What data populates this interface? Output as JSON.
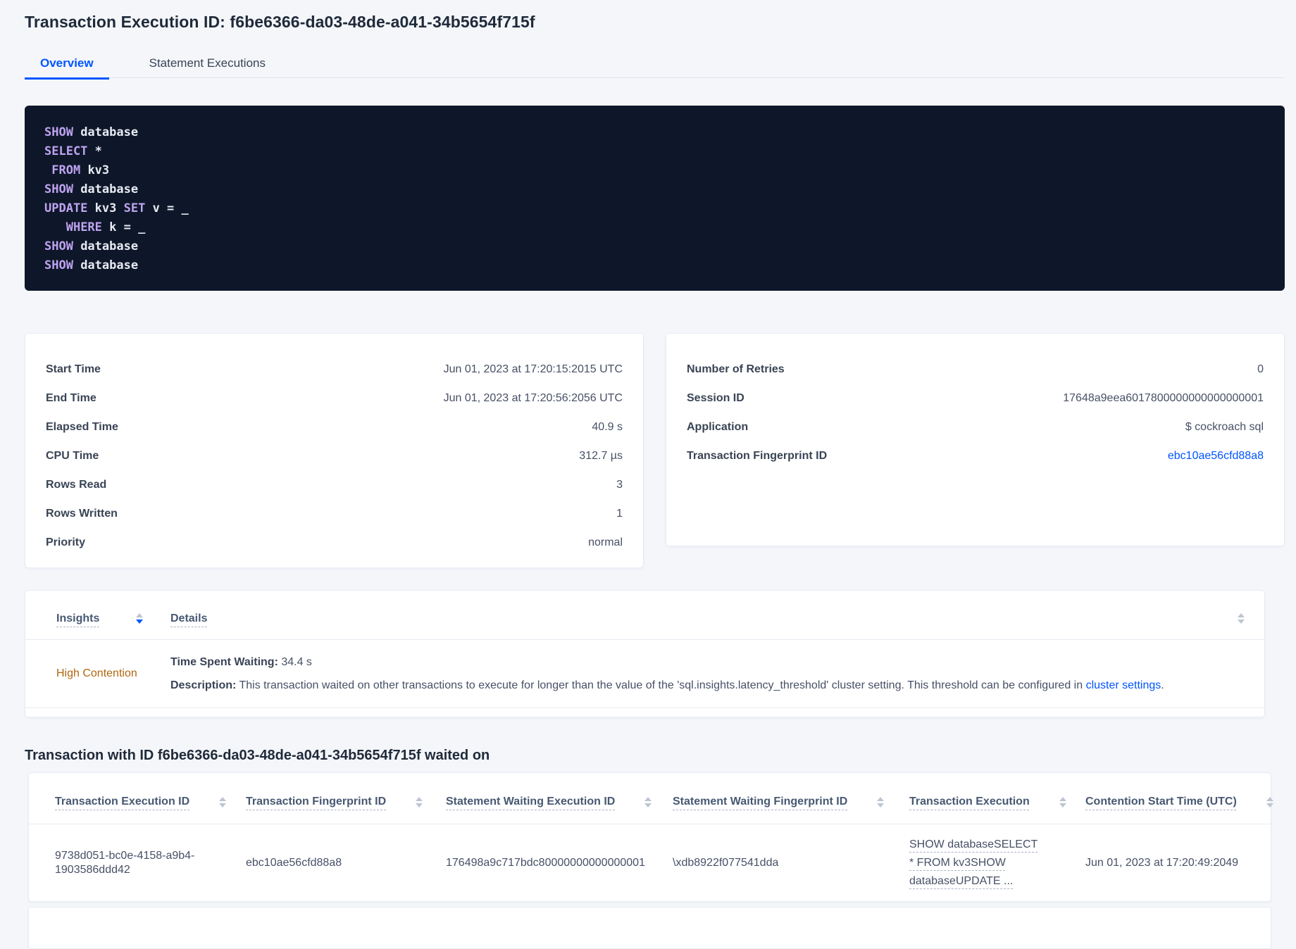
{
  "page": {
    "title": "Transaction Execution ID: f6be6366-da03-48de-a041-34b5654f715f"
  },
  "tabs": [
    {
      "label": "Overview"
    },
    {
      "label": "Statement Executions"
    }
  ],
  "colors": {
    "accent_blue": "#0055ff",
    "insight_orange": "#b0670f",
    "code_background": "#0e1729",
    "code_keyword": "#bfa4f1"
  },
  "sql": {
    "lines": [
      {
        "segs": [
          {
            "t": "SHOW"
          },
          {
            "t": " database"
          }
        ]
      },
      {
        "segs": [
          {
            "t": "SELECT"
          },
          {
            "t": " *"
          }
        ]
      },
      {
        "segs": [
          {
            "t": " "
          },
          {
            "t": "FROM"
          },
          {
            "t": " kv3"
          }
        ]
      },
      {
        "segs": [
          {
            "t": "SHOW"
          },
          {
            "t": " database"
          }
        ]
      },
      {
        "segs": [
          {
            "t": "UPDATE"
          },
          {
            "t": " kv3 "
          },
          {
            "t": "SET"
          },
          {
            "t": " v = _"
          }
        ]
      },
      {
        "segs": [
          {
            "t": "   "
          },
          {
            "t": "WHERE"
          },
          {
            "t": " k = _"
          }
        ]
      },
      {
        "segs": [
          {
            "t": "SHOW"
          },
          {
            "t": " database"
          }
        ]
      },
      {
        "segs": [
          {
            "t": "SHOW"
          },
          {
            "t": " database"
          }
        ]
      }
    ]
  },
  "summary_left": {
    "rows": [
      {
        "label": "Start Time",
        "value": "Jun 01, 2023 at 17:20:15:2015 UTC"
      },
      {
        "label": "End Time",
        "value": "Jun 01, 2023 at 17:20:56:2056 UTC"
      },
      {
        "label": "Elapsed Time",
        "value": "40.9 s"
      },
      {
        "label": "CPU Time",
        "value": "312.7 µs"
      },
      {
        "label": "Rows Read",
        "value": "3"
      },
      {
        "label": "Rows Written",
        "value": "1"
      },
      {
        "label": "Priority",
        "value": "normal"
      }
    ]
  },
  "summary_right": {
    "rows": [
      {
        "label": "Number of Retries",
        "value": "0"
      },
      {
        "label": "Session ID",
        "value": "17648a9eea6017800000000000000001"
      },
      {
        "label": "Application",
        "value": "$ cockroach sql"
      },
      {
        "label": "Transaction Fingerprint ID",
        "value": "ebc10ae56cfd88a8"
      }
    ]
  },
  "insights": {
    "columns": [
      "Insights",
      "Details"
    ],
    "row": {
      "insight": "High Contention",
      "waiting_label": "Time Spent Waiting:",
      "waiting_value": " 34.4 s",
      "description_label": "Description:",
      "description_text": " This transaction waited on other transactions to execute for longer than the value of the 'sql.insights.latency_threshold' cluster setting. This threshold can be configured in ",
      "description_link": "cluster settings",
      "description_suffix": "."
    }
  },
  "waited": {
    "title": "Transaction with ID f6be6366-da03-48de-a041-34b5654f715f waited on",
    "columns": [
      "Transaction Execution ID",
      "Transaction Fingerprint ID",
      "Statement Waiting Execution ID",
      "Statement Waiting Fingerprint ID",
      "Transaction Execution",
      "Contention Start Time (UTC)"
    ],
    "rows": [
      {
        "txn_execution_id": "9738d051-bc0e-4158-a9b4-1903586ddd42",
        "txn_fingerprint_id": "ebc10ae56cfd88a8",
        "stmt_waiting_execution_id": "176498a9c717bdc80000000000000001",
        "stmt_waiting_fingerprint_id": "\\xdb8922f077541dda",
        "txn_execution": "SHOW databaseSELECT * FROM kv3SHOW databaseUPDATE ...",
        "contention_start": "Jun 01, 2023 at 17:20:49:2049"
      }
    ]
  }
}
